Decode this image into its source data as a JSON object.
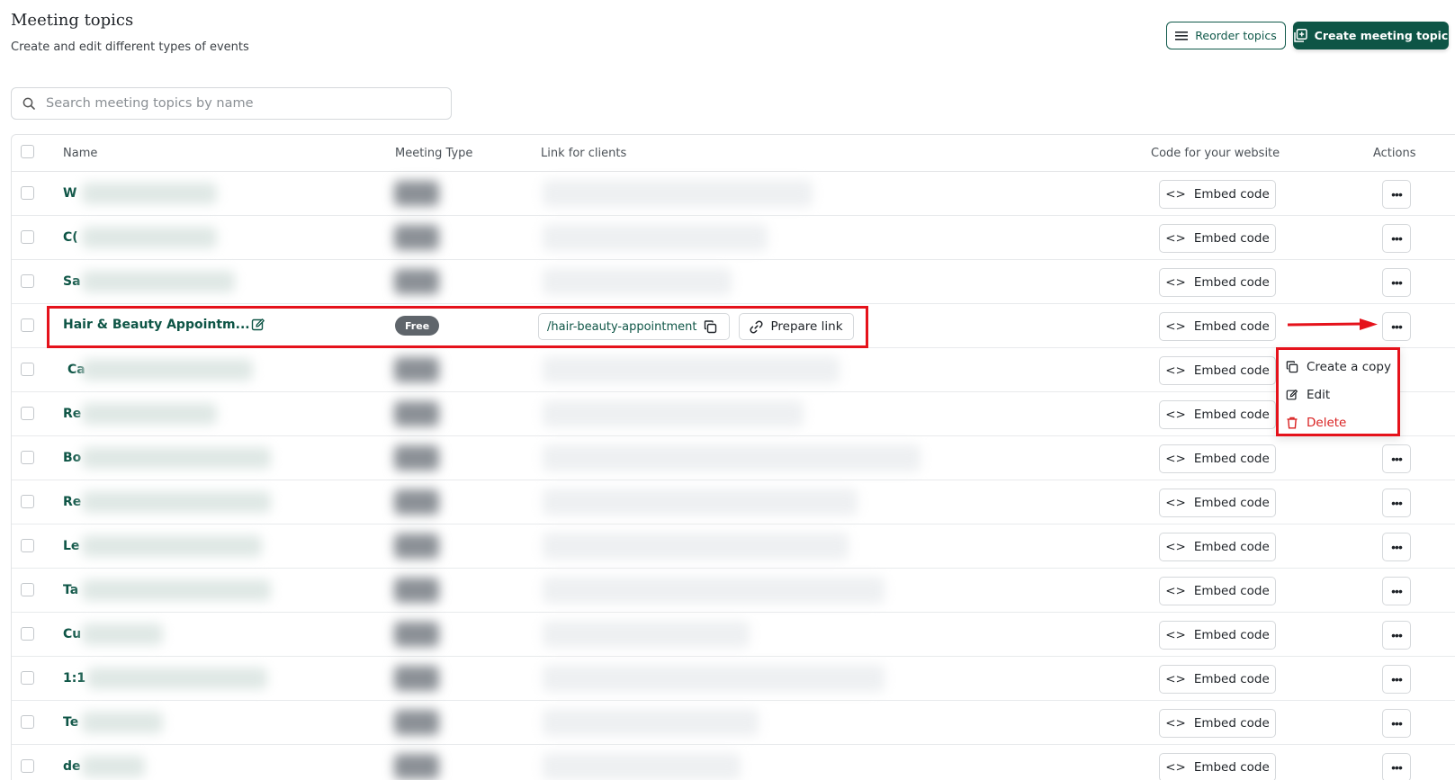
{
  "header": {
    "title": "Meeting topics",
    "subtitle": "Create and edit different types of events",
    "reorder_label": "Reorder topics",
    "create_label": "Create meeting topic"
  },
  "search": {
    "placeholder": "Search meeting topics by name"
  },
  "table": {
    "columns": [
      "Name",
      "Meeting Type",
      "Link for clients",
      "Code for your website",
      "Actions"
    ],
    "embed_label": "Embed code",
    "rows": [
      {
        "name_prefix": "W"
      },
      {
        "name_prefix": "C("
      },
      {
        "name_prefix": "Sa"
      },
      {
        "name": "Hair & Beauty Appointm...",
        "meeting_type": "Free",
        "link": "/hair-beauty-appointment",
        "prepare_label": "Prepare link",
        "highlighted": true
      },
      {
        "name_prefix": "Ca"
      },
      {
        "name_prefix": "Re"
      },
      {
        "name_prefix": "Bo"
      },
      {
        "name_prefix": "Re"
      },
      {
        "name_prefix": "Le"
      },
      {
        "name_prefix": "Ta"
      },
      {
        "name_prefix": "Cu"
      },
      {
        "name_prefix": "1:1"
      },
      {
        "name_prefix": "Te"
      },
      {
        "name_prefix": "de"
      }
    ]
  },
  "actions_menu": {
    "items": [
      {
        "label": "Create a copy",
        "icon": "copy-icon"
      },
      {
        "label": "Edit",
        "icon": "edit-icon"
      },
      {
        "label": "Delete",
        "icon": "trash-icon",
        "color": "#d92121"
      }
    ]
  },
  "colors": {
    "brand": "#0e5546",
    "annotation": "#e5121b",
    "danger": "#d92121"
  }
}
